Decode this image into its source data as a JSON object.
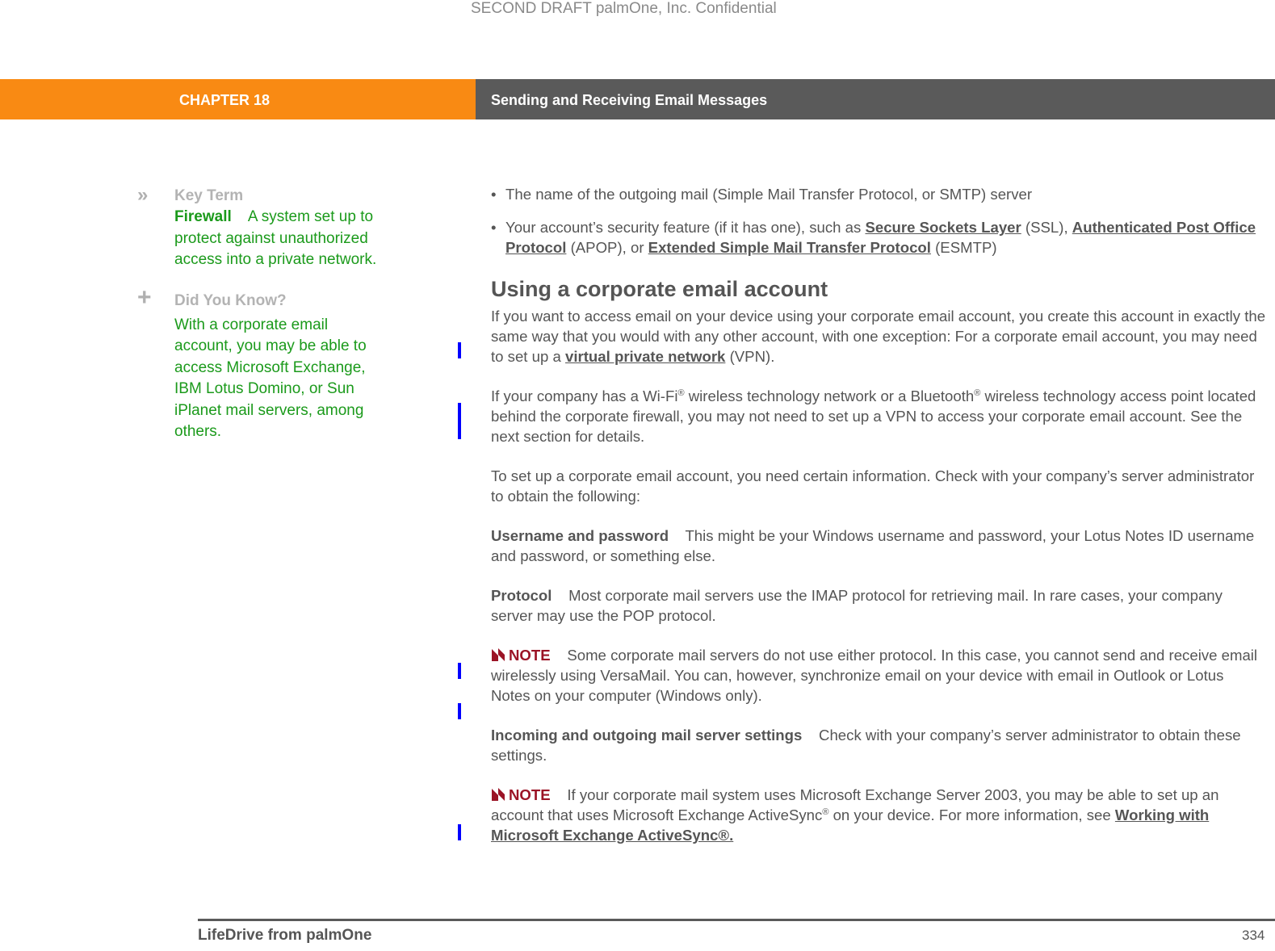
{
  "watermark": "SECOND DRAFT palmOne, Inc.  Confidential",
  "header": {
    "chapter": "CHAPTER 18",
    "title": "Sending and Receiving Email Messages",
    "colors": {
      "chapter_bg": "#f98a13",
      "title_bg": "#5a5a5a"
    }
  },
  "sidebar": {
    "key_term": {
      "icon": "double-chevron-right-icon",
      "heading": "Key Term",
      "term": "Firewall",
      "definition": "A system set up to protect against unauthorized access into a private network."
    },
    "did_you_know": {
      "icon": "plus-icon",
      "heading": "Did You Know?",
      "text": "With a corporate email account, you may be able to access Microsoft Exchange, IBM Lotus Domino, or Sun iPlanet mail servers, among others."
    },
    "text_color": "#1b9a1b"
  },
  "main": {
    "bullets": [
      {
        "text": "The name of the outgoing mail (Simple Mail Transfer Protocol, or SMTP) server"
      },
      {
        "pre": "Your account’s security feature (if it has one), such as ",
        "link1": "Secure Sockets Layer",
        "mid1": " (SSL), ",
        "link2": "Authenticated Post Office Protocol",
        "mid2": " (APOP), or ",
        "link3": "Extended Simple Mail Transfer Protocol",
        "post": " (ESMTP)"
      }
    ],
    "section_heading": "Using a corporate email account",
    "para1": {
      "pre": "If you want to access email on your device using your corporate email account, you create this account in exactly the same way that you would with any other account, with one exception: For a corporate email account, you may need to set up a ",
      "link": "virtual private network",
      "post": " (VPN)."
    },
    "para2": {
      "a": "If your company has a Wi-Fi",
      "b": " wireless technology network or a Bluetooth",
      "c": " wireless technology access point located behind the corporate firewall, you may not need to set up a VPN to access your corporate email account. See the next section for details.",
      "reg": "®"
    },
    "para3": "To set up a corporate email account, you need certain information. Check with your company’s server administrator to obtain the following:",
    "item_username": {
      "term": "Username and password",
      "text": "This might be your Windows username and password, your Lotus Notes ID username and password, or something else."
    },
    "item_protocol": {
      "term": "Protocol",
      "text": "Most corporate mail servers use the IMAP protocol for retrieving mail. In rare cases, your company server may use the POP protocol."
    },
    "note1": {
      "label": "NOTE",
      "text": "Some corporate mail servers do not use either protocol. In this case, you cannot send and receive email wirelessly using VersaMail. You can, however, synchronize email on your device with email in Outlook or Lotus Notes on your computer (Windows only)."
    },
    "item_servers": {
      "term": "Incoming and outgoing mail server settings",
      "text": "Check with your company’s server administrator to obtain these settings."
    },
    "note2": {
      "label": "NOTE",
      "a": "If your corporate mail system uses Microsoft Exchange Server 2003, you may be able to set up an account that uses Microsoft Exchange ActiveSync",
      "reg": "®",
      "b": " on your device. For more information, see ",
      "link": "Working with Microsoft Exchange ActiveSync®."
    },
    "note_color": "#9b1426",
    "change_bar_color": "#0000ff"
  },
  "footer": {
    "left": "LifeDrive from palmOne",
    "page_number": "334"
  }
}
